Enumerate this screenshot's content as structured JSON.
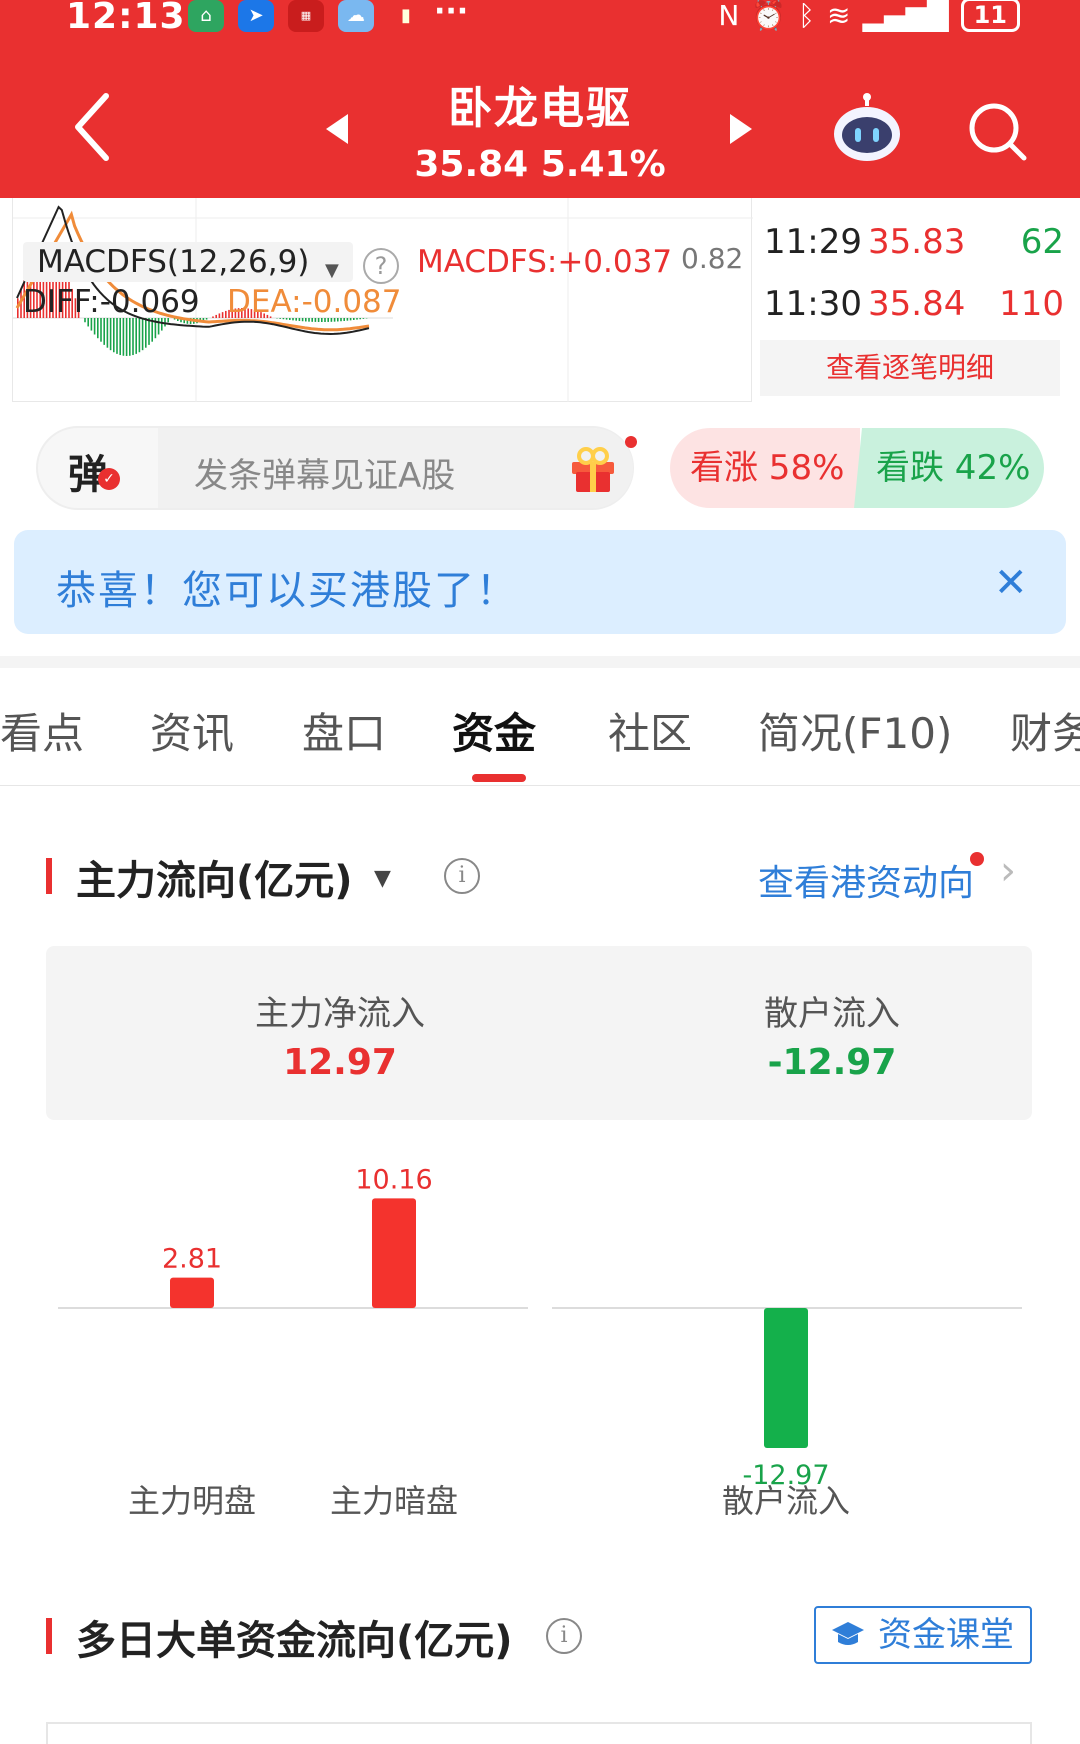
{
  "status_bar": {
    "time": "12:13",
    "dots": "···",
    "battery": "11"
  },
  "header": {
    "title": "卧龙电驱",
    "quote": "35.84 5.41%"
  },
  "macd": {
    "title": "MACDFS(12,26,9)",
    "help": "?",
    "macdfs": "MACDFS:+0.037",
    "axis_value": "0.82",
    "diff": "DIFF:-0.069",
    "dea": "DEA:-0.087"
  },
  "ticks": {
    "rows": [
      {
        "time": "11:29",
        "price": "35.83",
        "volume": "62",
        "volume_color": "#19a34a"
      },
      {
        "time": "11:30",
        "price": "35.84",
        "volume": "110",
        "volume_color": "#e93030"
      }
    ],
    "view_detail": "查看逐笔明细"
  },
  "danmu": {
    "icon_label": "弹",
    "placeholder": "发条弹幕见证A股"
  },
  "vote": {
    "up": "看涨 58%",
    "down": "看跌 42%",
    "up_pct": 58,
    "down_pct": 42
  },
  "banner": {
    "text": "恭喜！您可以买港股了！",
    "close": "✕"
  },
  "tabs": [
    "看点",
    "资讯",
    "盘口",
    "资金",
    "社区",
    "简况(F10)",
    "财务"
  ],
  "active_tab": "资金",
  "main_flow": {
    "title": "主力流向(亿元)",
    "hk_link": "查看港资动向",
    "summary": [
      {
        "label": "主力净流入",
        "value": "12.97",
        "color": "#e93030"
      },
      {
        "label": "散户流入",
        "value": "-12.97",
        "color": "#19a34a"
      }
    ]
  },
  "chart_data": {
    "type": "bar",
    "categories": [
      "主力明盘",
      "主力暗盘",
      "散户流入"
    ],
    "values": [
      2.81,
      10.16,
      -12.97
    ],
    "value_labels": [
      "2.81",
      "10.16",
      "-12.97"
    ],
    "colors": [
      "#f4332d",
      "#f4332d",
      "#14b04b"
    ],
    "title": "",
    "ylim": [
      -12.97,
      12.97
    ]
  },
  "multi_day": {
    "title": "多日大单资金流向(亿元)",
    "course_button": "资金课堂"
  },
  "colors": {
    "header": "#e93030",
    "up": "#e93030",
    "down": "#19a34a",
    "link": "#2f7ed8"
  }
}
